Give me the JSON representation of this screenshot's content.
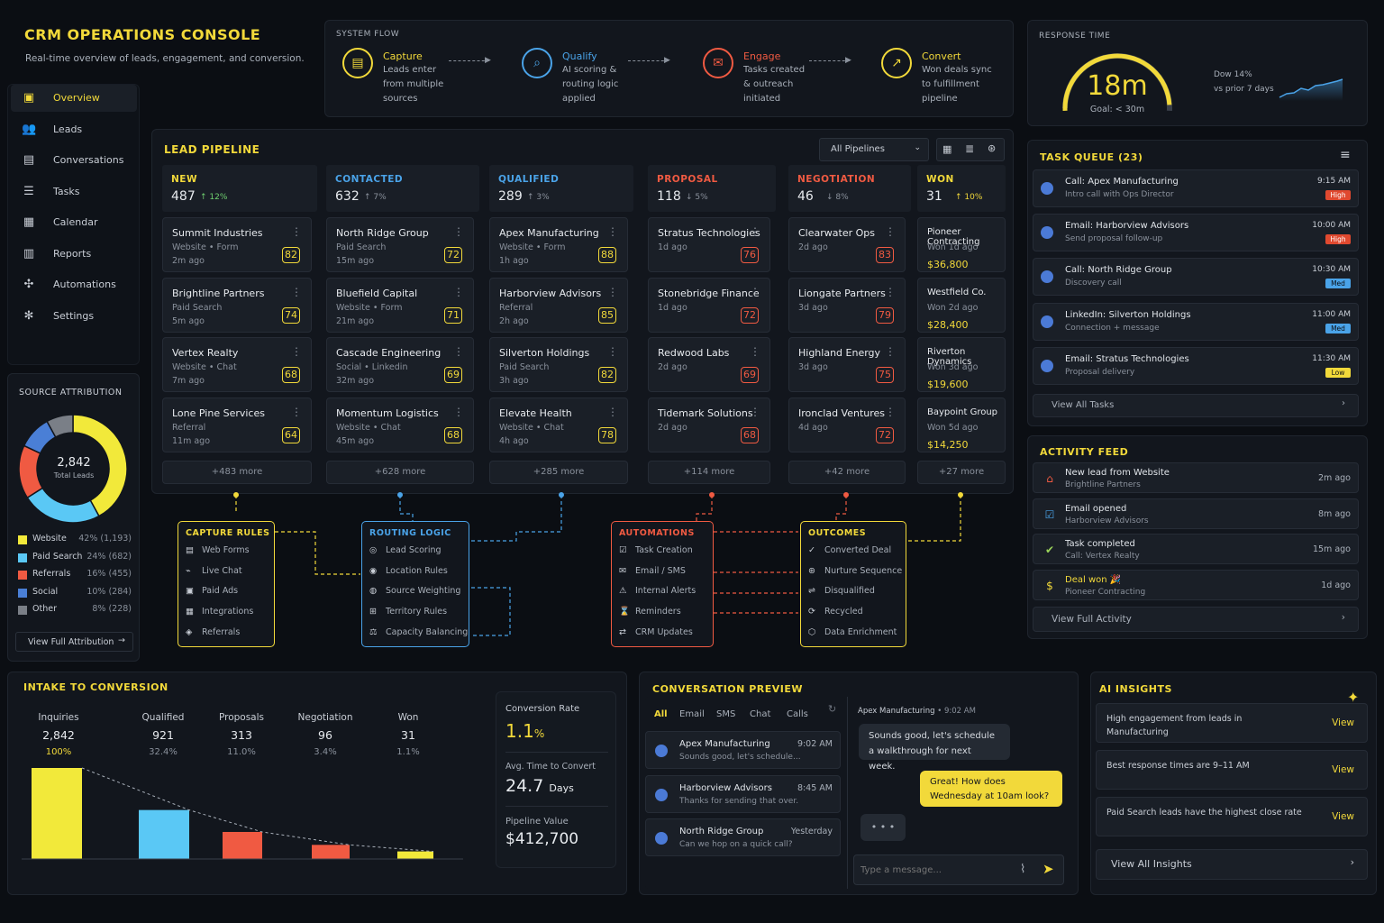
{
  "header": {
    "title": "CRM OPERATIONS CONSOLE",
    "subtitle": "Real-time overview of leads, engagement, and conversion."
  },
  "nav": [
    {
      "label": "Overview",
      "icon": "dashboard-icon",
      "active": true
    },
    {
      "label": "Leads",
      "icon": "users-icon"
    },
    {
      "label": "Conversations",
      "icon": "chat-icon"
    },
    {
      "label": "Tasks",
      "icon": "checklist-icon"
    },
    {
      "label": "Calendar",
      "icon": "calendar-icon"
    },
    {
      "label": "Reports",
      "icon": "bar-chart-icon"
    },
    {
      "label": "Automations",
      "icon": "automation-icon"
    },
    {
      "label": "Settings",
      "icon": "gear-icon"
    }
  ],
  "system_flow": {
    "label": "SYSTEM FLOW",
    "steps": [
      {
        "title": "Capture",
        "lines": [
          "Leads enter",
          "from multiple",
          "sources"
        ],
        "color": "#f2d93a",
        "icon": "capture-icon"
      },
      {
        "title": "Qualify",
        "lines": [
          "AI scoring &",
          "routing logic",
          "applied"
        ],
        "color": "#4aa3e8",
        "icon": "qualify-icon"
      },
      {
        "title": "Engage",
        "lines": [
          "Tasks created",
          "& outreach",
          "initiated"
        ],
        "color": "#f05a42",
        "icon": "engage-icon"
      },
      {
        "title": "Convert",
        "lines": [
          "Won deals sync",
          "to fulfillment",
          "pipeline"
        ],
        "color": "#f2d93a",
        "icon": "convert-icon"
      }
    ]
  },
  "response_time": {
    "label": "RESPONSE TIME",
    "value": "18m",
    "goal": "Goal: < 30m",
    "delta": "Dow 14%",
    "compare": "vs prior 7 days",
    "gauge_fraction": 0.6
  },
  "pipeline": {
    "title": "LEAD PIPELINE",
    "filter": "All Pipelines",
    "columns": [
      {
        "name": "NEW",
        "count": "487",
        "delta": "↑ 12%",
        "color": "#f2d93a",
        "deltaColor": "#6fcf6f",
        "cards": [
          {
            "name": "Summit Industries",
            "src": "Website • Form",
            "age": "2m ago",
            "score": "82"
          },
          {
            "name": "Brightline Partners",
            "src": "Paid Search",
            "age": "5m ago",
            "score": "74"
          },
          {
            "name": "Vertex Realty",
            "src": "Website • Chat",
            "age": "7m ago",
            "score": "68"
          },
          {
            "name": "Lone Pine Services",
            "src": "Referral",
            "age": "11m ago",
            "score": "64"
          }
        ],
        "more": "+483 more"
      },
      {
        "name": "CONTACTED",
        "count": "632",
        "delta": "↑ 7%",
        "color": "#4aa3e8",
        "deltaColor": "#8a919c",
        "cards": [
          {
            "name": "North Ridge Group",
            "src": "Paid Search",
            "age": "15m ago",
            "score": "72"
          },
          {
            "name": "Bluefield Capital",
            "src": "Website • Form",
            "age": "21m ago",
            "score": "71"
          },
          {
            "name": "Cascade Engineering",
            "src": "Social • Linkedin",
            "age": "32m ago",
            "score": "69"
          },
          {
            "name": "Momentum Logistics",
            "src": "Website • Chat",
            "age": "45m ago",
            "score": "68"
          }
        ],
        "more": "+628 more"
      },
      {
        "name": "QUALIFIED",
        "count": "289",
        "delta": "↑ 3%",
        "color": "#4aa3e8",
        "deltaColor": "#8a919c",
        "cards": [
          {
            "name": "Apex Manufacturing",
            "src": "Website • Form",
            "age": "1h ago",
            "score": "88"
          },
          {
            "name": "Harborview Advisors",
            "src": "Referral",
            "age": "2h ago",
            "score": "85"
          },
          {
            "name": "Silverton Holdings",
            "src": "Paid Search",
            "age": "3h ago",
            "score": "82"
          },
          {
            "name": "Elevate Health",
            "src": "Website • Chat",
            "age": "4h ago",
            "score": "78"
          }
        ],
        "more": "+285 more"
      },
      {
        "name": "PROPOSAL",
        "count": "118",
        "delta": "↓ 5%",
        "color": "#f05a42",
        "deltaColor": "#8a919c",
        "cards": [
          {
            "name": "Stratus Technologies",
            "src": "1d ago",
            "age": "",
            "score": "76"
          },
          {
            "name": "Stonebridge Finance",
            "src": "1d ago",
            "age": "",
            "score": "72"
          },
          {
            "name": "Redwood Labs",
            "src": "2d ago",
            "age": "",
            "score": "69"
          },
          {
            "name": "Tidemark Solutions",
            "src": "2d ago",
            "age": "",
            "score": "68"
          }
        ],
        "more": "+114 more"
      },
      {
        "name": "NEGOTIATION",
        "count": "46",
        "delta": "↓ 8%",
        "color": "#f05a42",
        "deltaColor": "#8a919c",
        "cards": [
          {
            "name": "Clearwater Ops",
            "src": "2d ago",
            "age": "",
            "score": "83"
          },
          {
            "name": "Liongate Partners",
            "src": "3d ago",
            "age": "",
            "score": "79"
          },
          {
            "name": "Highland Energy",
            "src": "3d ago",
            "age": "",
            "score": "75"
          },
          {
            "name": "Ironclad Ventures",
            "src": "4d ago",
            "age": "",
            "score": "72"
          }
        ],
        "more": "+42 more"
      },
      {
        "name": "WON",
        "count": "31",
        "delta": "↑ 10%",
        "color": "#f2d93a",
        "deltaColor": "#f2d93a",
        "cards": [
          {
            "name": "Pioneer Contracting",
            "src": "Won 1d ago",
            "age": "$36,800"
          },
          {
            "name": "Westfield Co.",
            "src": "Won 2d ago",
            "age": "$28,400"
          },
          {
            "name": "Riverton Dynamics",
            "src": "Won 3d ago",
            "age": "$19,600"
          },
          {
            "name": "Baypoint Group",
            "src": "Won 5d ago",
            "age": "$14,250"
          }
        ],
        "more": "+27 more"
      }
    ]
  },
  "source_attribution": {
    "title": "SOURCE ATTRIBUTION",
    "total": "2,842",
    "total_label": "Total Leads",
    "items": [
      {
        "label": "Website",
        "pct": "42% (1,193)",
        "value": 42,
        "color": "#f2e93a"
      },
      {
        "label": "Paid Search",
        "pct": "24%  (682)",
        "value": 24,
        "color": "#5ac8f5"
      },
      {
        "label": "Referrals",
        "pct": "16%  (455)",
        "value": 16,
        "color": "#f05a42"
      },
      {
        "label": "Social",
        "pct": "10%  (284)",
        "value": 10,
        "color": "#4a7fd6"
      },
      {
        "label": "Other",
        "pct": "8%  (228)",
        "value": 8,
        "color": "#7a7f87"
      }
    ],
    "button": "View Full Attribution"
  },
  "flow": {
    "capture": {
      "title": "CAPTURE RULES",
      "items": [
        "Web Forms",
        "Live Chat",
        "Paid Ads",
        "Integrations",
        "Referrals"
      ]
    },
    "routing": {
      "title": "ROUTING LOGIC",
      "items": [
        "Lead Scoring",
        "Location Rules",
        "Source Weighting",
        "Territory Rules",
        "Capacity Balancing"
      ]
    },
    "automations": {
      "title": "AUTOMATIONS",
      "items": [
        "Task Creation",
        "Email / SMS",
        "Internal Alerts",
        "Reminders",
        "CRM Updates"
      ]
    },
    "outcomes": {
      "title": "OUTCOMES",
      "items": [
        "Converted Deal",
        "Nurture Sequence",
        "Disqualified",
        "Recycled",
        "Data Enrichment"
      ]
    }
  },
  "tasks": {
    "title": "TASK QUEUE (23)",
    "items": [
      {
        "title": "Call: Apex Manufacturing",
        "sub": "Intro call with Ops Director",
        "time": "9:15 AM",
        "priority": "High"
      },
      {
        "title": "Email: Harborview Advisors",
        "sub": "Send proposal follow-up",
        "time": "10:00 AM",
        "priority": "High"
      },
      {
        "title": "Call: North Ridge Group",
        "sub": "Discovery call",
        "time": "10:30 AM",
        "priority": "Med"
      },
      {
        "title": "LinkedIn: Silverton Holdings",
        "sub": "Connection + message",
        "time": "11:00 AM",
        "priority": "Med"
      },
      {
        "title": "Email: Stratus Technologies",
        "sub": "Proposal delivery",
        "time": "11:30 AM",
        "priority": "Low"
      }
    ],
    "view_all": "View All Tasks"
  },
  "activity": {
    "title": "ACTIVITY FEED",
    "items": [
      {
        "title": "New lead from Website",
        "sub": "Brightline Partners",
        "time": "2m ago"
      },
      {
        "title": "Email opened",
        "sub": "Harborview Advisors",
        "time": "8m ago"
      },
      {
        "title": "Task completed",
        "sub": "Call: Vertex Realty",
        "time": "15m ago"
      },
      {
        "title": "Deal won 🎉",
        "sub": "Pioneer Contracting",
        "time": "1d ago"
      }
    ],
    "view_all": "View Full Activity"
  },
  "intake": {
    "title": "INTAKE TO CONVERSION"
  },
  "chart_data": {
    "type": "bar",
    "title": "INTAKE TO CONVERSION",
    "categories": [
      "Inquiries",
      "Qualified",
      "Proposals",
      "Negotiation",
      "Won"
    ],
    "values": [
      2842,
      921,
      313,
      96,
      31
    ],
    "value_labels": [
      "2,842",
      "921",
      "313",
      "96",
      "31"
    ],
    "pct_labels": [
      "100%",
      "32.4%",
      "11.0%",
      "3.4%",
      "1.1%"
    ],
    "colors": [
      "#f2e93a",
      "#5ac8f5",
      "#f05a42",
      "#f05a42",
      "#f2e93a"
    ]
  },
  "metrics": {
    "rate_label": "Conversion Rate",
    "rate": "1.1",
    "rate_unit": "%",
    "time_label": "Avg. Time to Convert",
    "time": "24.7",
    "time_unit": "Days",
    "value_label": "Pipeline Value",
    "value": "$412,700"
  },
  "conversation": {
    "title": "CONVERSATION PREVIEW",
    "tabs": [
      "All",
      "Email",
      "SMS",
      "Chat",
      "Calls"
    ],
    "threads": [
      {
        "name": "Apex Manufacturing",
        "msg": "Sounds good, let's schedule...",
        "time": "9:02 AM"
      },
      {
        "name": "Harborview Advisors",
        "msg": "Thanks for sending that over.",
        "time": "8:45 AM"
      },
      {
        "name": "North Ridge Group",
        "msg": "Can we hop on a quick call?",
        "time": "Yesterday"
      }
    ],
    "chat_header": "Apex Manufacturing",
    "chat_time": "• 9:02 AM",
    "incoming": "Sounds good, let's schedule a walkthrough for next week.",
    "outgoing": "Great! How does Wednesday at 10am look?",
    "typing": "• • •",
    "placeholder": "Type a message..."
  },
  "insights": {
    "title": "AI INSIGHTS",
    "items": [
      {
        "text": "High engagement from leads in Manufacturing",
        "action": "View"
      },
      {
        "text": "Best response times are 9–11 AM",
        "action": "View"
      },
      {
        "text": "Paid Search leads have the highest close rate",
        "action": "View"
      }
    ],
    "view_all": "View All Insights"
  }
}
